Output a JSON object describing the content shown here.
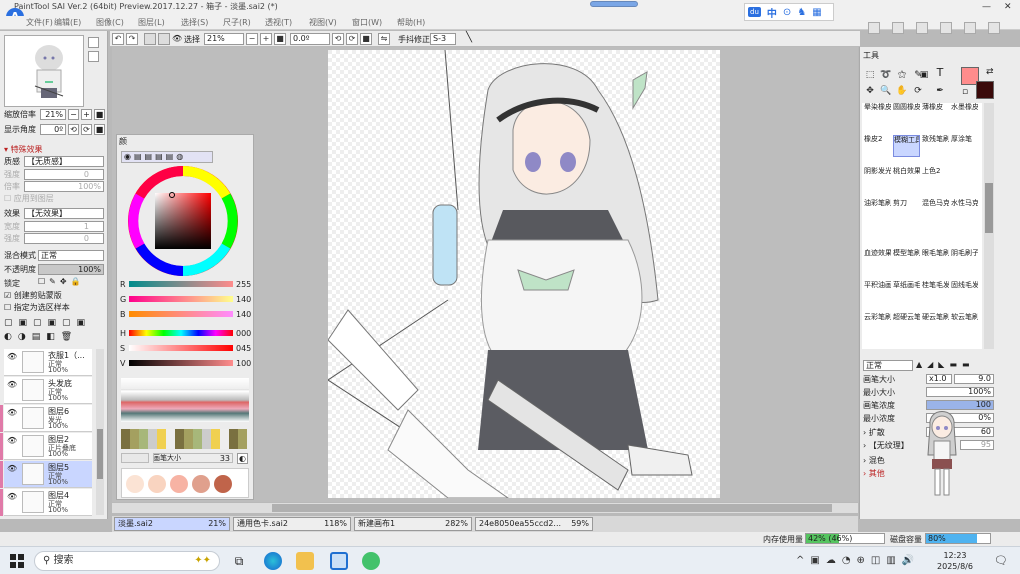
{
  "title_bar": {
    "title": "PaintTool SAI Ver.2 (64bit) Preview.2017.12.27 - 箱子 - 淡墨.sai2 (*)"
  },
  "menu": {
    "items": [
      "文件(F)",
      "编辑(E)",
      "图像(C)",
      "图层(L)",
      "选择(S)",
      "尺子(R)",
      "透视(T)",
      "视图(V)",
      "窗口(W)",
      "帮助(H)"
    ]
  },
  "ime": {
    "badge": "du",
    "lang": "中"
  },
  "toolbar": {
    "select_label": "选择",
    "zoom": "21%",
    "angle": "0.0º",
    "stabilizer_label": "手抖修正",
    "stabilizer_value": "S-3"
  },
  "left_panel": {
    "zoom_label": "缩放倍率",
    "zoom_value": "21%",
    "rotation_label": "显示角度",
    "rotation_value": "0º",
    "effects_header": "特殊效果",
    "texture_label": "质感",
    "texture_value": "【无质感】",
    "strength_label": "强度",
    "strength_value": "0",
    "scale_label": "倍率",
    "scale_value": "100%",
    "apply_layer_label": "应用到图层",
    "effect_label": "效果",
    "effect_value": "【无效果】",
    "width_label": "宽度",
    "width_value": "1",
    "intensity_label": "强度",
    "intensity_value": "0",
    "blend_label": "混合模式",
    "blend_value": "正常",
    "opacity_label": "不透明度",
    "opacity_value": "100%",
    "lock_label": "锁定",
    "clipping_label": "创建剪贴蒙版",
    "selection_source_label": "指定为选区样本",
    "layers": [
      {
        "name": "衣服1（...",
        "mode": "正常",
        "opacity": "100%",
        "visible": true,
        "selected": false
      },
      {
        "name": "头发底",
        "mode": "正常",
        "opacity": "100%",
        "visible": true,
        "selected": false
      },
      {
        "name": "图层6",
        "mode": "发光",
        "opacity": "100%",
        "visible": true,
        "selected": false
      },
      {
        "name": "图层2",
        "mode": "正片叠底",
        "opacity": "100%",
        "visible": true,
        "selected": false
      },
      {
        "name": "图层5",
        "mode": "正常",
        "opacity": "100%",
        "visible": true,
        "selected": true
      },
      {
        "name": "图层4",
        "mode": "正常",
        "opacity": "100%",
        "visible": true,
        "selected": false
      }
    ]
  },
  "color_panel": {
    "title": "颜",
    "sliders": [
      {
        "label": "R",
        "value": "255"
      },
      {
        "label": "G",
        "value": "140"
      },
      {
        "label": "B",
        "value": "140"
      },
      {
        "label": "H",
        "value": "000"
      },
      {
        "label": "S",
        "value": "045"
      },
      {
        "label": "V",
        "value": "100"
      }
    ],
    "brush_size_label": "画笔大小",
    "brush_size_value": "33"
  },
  "tool_panel": {
    "title": "工具",
    "fg_color": "#ff8c8c",
    "bg_color": "#3a0a0a",
    "brushes": [
      "晕染橡皮擦",
      "圆圆橡皮擦",
      "薄橡皮",
      "水墨橡皮擦",
      "橡皮2",
      "模糊工具",
      "致残笔刷",
      "厚涂笔",
      "阴影发光",
      "桃白效果",
      "上色2",
      "",
      "油彩笔刷",
      "剪刀",
      "混色马克笔",
      "水性马克笔",
      "血迹效果",
      "模型笔刷",
      "眼毛笔刷",
      "阴毛刷子",
      "平积油画笔",
      "草纸画毛发",
      "桂笔毛发",
      "固线毛发",
      "云彩笔刷",
      "超硬云笔刷",
      "硬云笔刷",
      "软云笔刷"
    ],
    "blend_mode": "正常",
    "size_label": "画笔大小",
    "size_mult": "x1.0",
    "size_value": "9.0",
    "min_size_label": "最小大小",
    "min_size_value": "100%",
    "density_label": "画笔浓度",
    "density_value": "100",
    "min_density_label": "最小浓度",
    "min_density_value": "0%",
    "spread_label": "扩散",
    "spread_value": "60",
    "texture_label": "【无纹理】",
    "texture_value": "95",
    "mix_label": "混色",
    "other_label": "其他"
  },
  "tabs": [
    {
      "name": "淡墨.sai2",
      "zoom": "21%",
      "active": true
    },
    {
      "name": "通用色卡.sai2",
      "zoom": "118%",
      "active": false
    },
    {
      "name": "新建画布1",
      "zoom": "282%",
      "active": false
    },
    {
      "name": "24e8050ea55ccd2...",
      "zoom": "59%",
      "active": false
    }
  ],
  "status": {
    "memory_label": "内存使用量",
    "memory_value": "42% (46%)",
    "memory_fraction": 0.42,
    "disk_label": "磁盘容量",
    "disk_value": "80%",
    "disk_fraction": 0.8
  },
  "taskbar": {
    "search_placeholder": "搜索",
    "time": "12:23",
    "date": "2025/8/6"
  }
}
